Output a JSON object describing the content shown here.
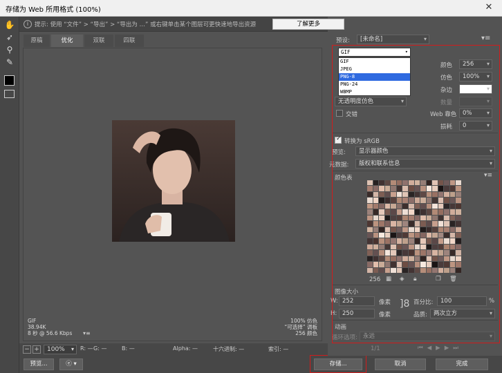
{
  "window": {
    "title": "存储为 Web 所用格式 (100%)",
    "close_glyph": "✕"
  },
  "hint": {
    "text": "提示: 使用 “文件” > “导出” > “导出为 …” 或右键单击某个图层可更快速地导出资源",
    "learn_more": "了解更多"
  },
  "tabs": [
    {
      "label": "原稿",
      "active": false
    },
    {
      "label": "优化",
      "active": true
    },
    {
      "label": "双联",
      "active": false
    },
    {
      "label": "四联",
      "active": false
    }
  ],
  "preview_info": {
    "format": "GIF",
    "size": "38.94K",
    "time": "8 秒 @ 56.6 Kbps",
    "menu_glyph": "▾≡",
    "dither_pct": "100% 仿色",
    "palette": "“可选择” 调板",
    "colors_count": "256 颜色"
  },
  "statusbar": {
    "minus": "−",
    "plus": "+",
    "zoom": "100%",
    "r": "R: —",
    "g": "G: —",
    "b": "B: —",
    "alpha": "Alpha: —",
    "hex": "十六进制: —",
    "index": "索引: —"
  },
  "footer": {
    "preview_btn": "预览...",
    "save_btn": "存储...",
    "cancel_btn": "取消",
    "done_btn": "完成"
  },
  "right_panel": {
    "preset_label": "预设:",
    "preset_value": "[未命名]",
    "format_value": "GIF",
    "format_options": [
      "GIF",
      "JPEG",
      "PNG-8",
      "PNG-24",
      "WBMP"
    ],
    "format_selected": "PNG-8",
    "colors_label": "颜色",
    "colors_value": "256",
    "dither_label": "仿色",
    "dither_value": "100%",
    "matte_label": "杂边",
    "amount_label": "数量",
    "transparency_dither": "无透明度仿色",
    "interlaced_label": "交错",
    "web_snap_label": "Web 靠色",
    "web_snap_value": "0%",
    "lossy_label": "损耗",
    "lossy_value": "0",
    "convert_srgb": "转换为 sRGB",
    "preview_label": "预览:",
    "preview_value": "显示器颜色",
    "metadata_label": "元数据:",
    "metadata_value": "版权和联系信息",
    "color_table_label": "颜色表",
    "color_count": "256",
    "image_size_label": "图像大小",
    "w_label": "W:",
    "w_value": "252",
    "h_label": "H:",
    "h_value": "250",
    "px_label": "像素",
    "percent_label": "百分比:",
    "percent_value": "100",
    "percent_unit": "%",
    "quality_label": "品质:",
    "quality_value": "两次立方",
    "animation_label": "动画",
    "loop_label": "循环选项:",
    "loop_value": "永远",
    "frame_counter": "1/1"
  },
  "colors": {
    "highlight": "#d21c1c",
    "selection": "#2f6ae0"
  }
}
